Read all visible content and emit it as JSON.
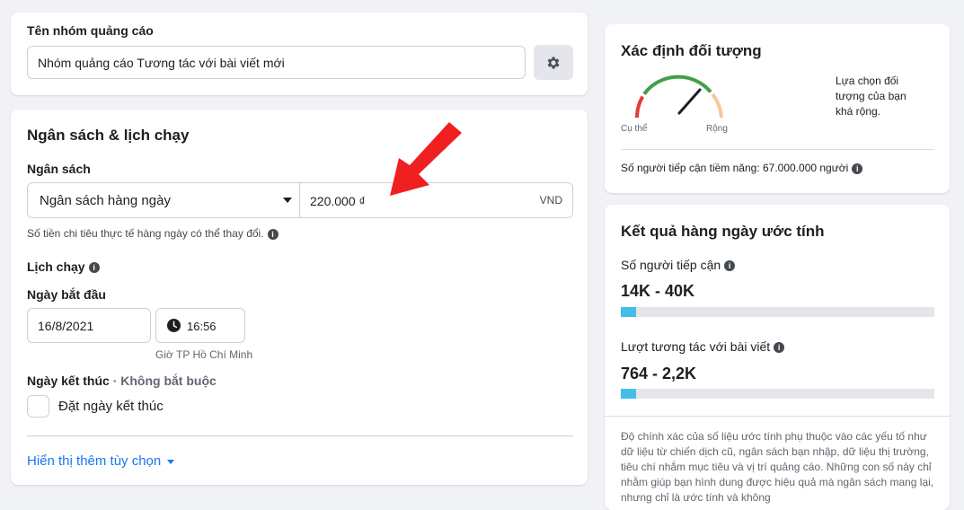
{
  "ad_set_name": {
    "label": "Tên nhóm quảng cáo",
    "value": "Nhóm quảng cáo Tương tác với bài viết mới"
  },
  "budget_schedule": {
    "title": "Ngân sách & lịch chạy",
    "budget_label": "Ngân sách",
    "budget_type": "Ngân sách hàng ngày",
    "budget_amount": "220.000 ₫",
    "currency": "VND",
    "budget_note": "Số tiền chi tiêu thực tế hàng ngày có thể thay đổi.",
    "schedule_label": "Lịch chạy",
    "start_date_label": "Ngày bắt đầu",
    "start_date": "16/8/2021",
    "start_time": "16:56",
    "timezone": "Giờ TP Hồ Chí Minh",
    "end_date_label": "Ngày kết thúc",
    "end_date_optional": "· Không bắt buộc",
    "set_end_date": "Đặt ngày kết thúc",
    "show_more": "Hiển thị thêm tùy chọn"
  },
  "audience": {
    "title": "Xác định đối tượng",
    "gauge_left": "Cụ thể",
    "gauge_right": "Rộng",
    "description": "Lựa chọn đối tượng của bạn khá rộng.",
    "potential_reach": "Số người tiếp cận tiềm năng: 67.000.000 người"
  },
  "estimates": {
    "title": "Kết quả hàng ngày ước tính",
    "reach_label": "Số người tiếp cận",
    "reach_value": "14K - 40K",
    "reach_fill": 0.05,
    "engagement_label": "Lượt tương tác với bài viết",
    "engagement_value": "764 - 2,2K",
    "engagement_fill": 0.05,
    "disclaimer": "Độ chính xác của số liệu ước tính phụ thuộc vào các yếu tố như dữ liệu từ chiến dịch cũ, ngân sách bạn nhập, dữ liệu thị trường, tiêu chí nhắm mục tiêu và vị trí quảng cáo. Những con số này chỉ nhằm giúp bạn hình dung được hiệu quả mà ngân sách mang lại, nhưng chỉ là ước tính và không"
  },
  "colors": {
    "accent": "#1877f2",
    "bar": "#45bde8",
    "arrow": "#f02020"
  }
}
